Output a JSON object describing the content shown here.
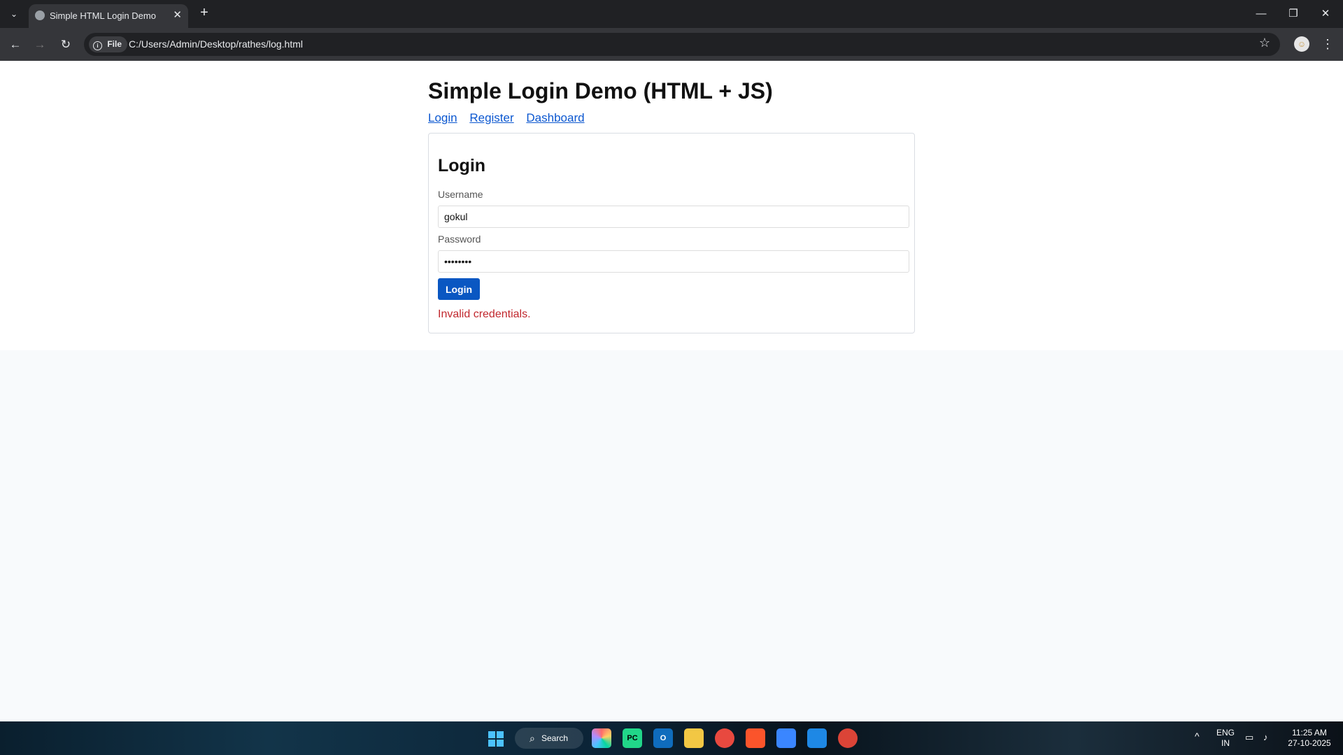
{
  "browser": {
    "tab_title": "Simple HTML Login Demo",
    "tab_close": "✕",
    "new_tab": "+",
    "tab_list": "⌄",
    "file_chip": "File",
    "info_icon": "i",
    "url": "C:/Users/Admin/Desktop/rathes/log.html",
    "back": "←",
    "forward": "→",
    "reload": "↻",
    "star": "☆",
    "menu": "⋮",
    "minimize": "—",
    "restore": "❐",
    "close": "✕"
  },
  "page": {
    "heading": "Simple Login Demo (HTML + JS)",
    "nav": [
      "Login",
      "Register",
      "Dashboard"
    ],
    "card_title": "Login",
    "username_label": "Username",
    "username_value": "gokul",
    "password_label": "Password",
    "password_value": "••••••••",
    "submit_label": "Login",
    "error_text": "Invalid credentials."
  },
  "taskbar": {
    "search_label": "Search",
    "search_icon": "⌕",
    "apps": [
      "Copilot",
      "PyCharm",
      "Outlook",
      "File Explorer",
      "Chrome",
      "Brave",
      "Microsoft Store",
      "VS Code",
      "Chrome"
    ],
    "tray_caret": "^",
    "language_line1": "ENG",
    "language_line2": "IN",
    "time": "11:25 AM",
    "date": "27-10-2025"
  },
  "colors": {
    "accent": "#0a57c2",
    "error": "#c1272d",
    "link": "#0b57d0"
  }
}
